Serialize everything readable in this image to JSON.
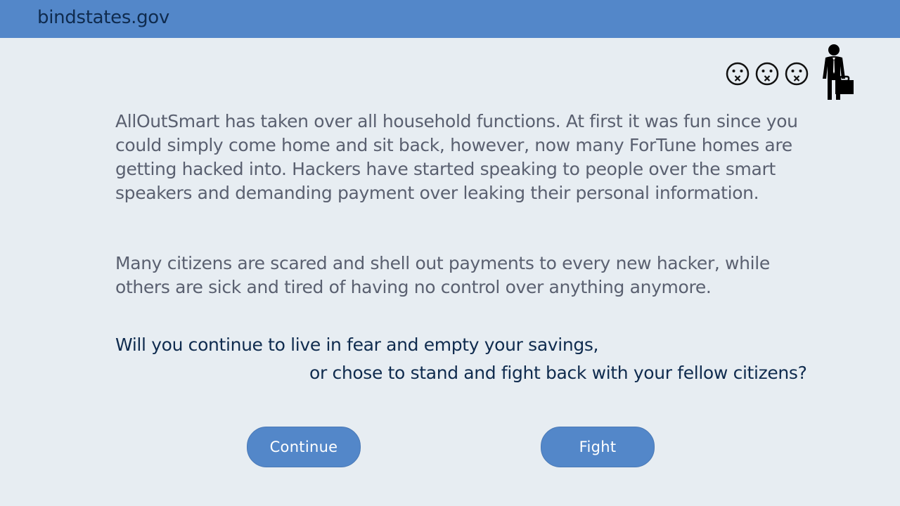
{
  "header": {
    "site_name": "bindstates.gov"
  },
  "status": {
    "face_icons": [
      "sad-face-icon",
      "sad-face-icon",
      "sad-face-icon"
    ],
    "avatar_icon": "businessman-with-briefcase-icon"
  },
  "story": {
    "paragraph_1": "AllOutSmart has taken over all household functions. At first it was fun since you could simply come home and sit back, however, now many ForTune homes are getting hacked into. Hackers have started speaking to people over the smart speakers and demanding payment over leaking their personal information.",
    "paragraph_2": "Many citizens are scared and shell out payments to every new hacker, while others are sick and tired of having no control over anything anymore.",
    "question_line_1": "Will you continue to live in fear and empty your savings,",
    "question_line_2": "or chose to stand and fight back with your fellow citizens?"
  },
  "choices": {
    "continue_label": "Continue",
    "fight_label": "Fight"
  },
  "colors": {
    "header_bg": "#5387c9",
    "page_bg": "#e7edf2",
    "body_text": "#5a6070",
    "question_text": "#0f2b4e",
    "button_bg": "#5387c9"
  }
}
